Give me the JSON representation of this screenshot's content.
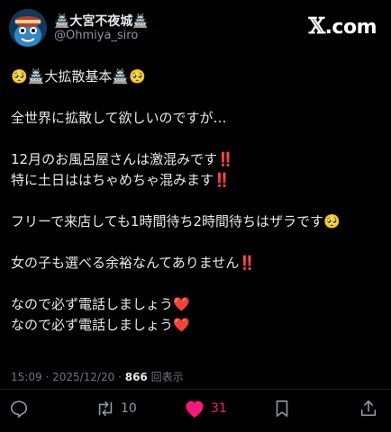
{
  "author": {
    "display_name": "🏯大宮不夜城🏯",
    "handle": "@Ohmiya_siro"
  },
  "brand": {
    "logo_text": ".com"
  },
  "post": {
    "lines": [
      "🥺🏯大拡散基本🏯🥺",
      "",
      "全世界に拡散して欲しいのですが…",
      "",
      "12月のお風呂屋さんは激混みです‼️",
      "特に土日ははちゃめちゃ混みます‼️",
      "",
      "フリーで来店しても1時間待ち2時間待ちはザラです🥺",
      "",
      "女の子も選べる余裕なんてありません‼️",
      "",
      "なので必ず電話しましょう❤️",
      "なので必ず電話しましょう❤️"
    ]
  },
  "meta": {
    "time": "15:09",
    "separator1": "·",
    "date": "2025/12/20",
    "separator2": "·",
    "views_count": "866",
    "views_label": "回表示"
  },
  "actions": {
    "reply_icon": "reply-icon",
    "retweet_icon": "retweet-icon",
    "retweet_count": "10",
    "like_icon": "heart-icon",
    "like_count": "31",
    "like_color": "#f91880",
    "bookmark_icon": "bookmark-icon",
    "share_icon": "share-icon"
  }
}
